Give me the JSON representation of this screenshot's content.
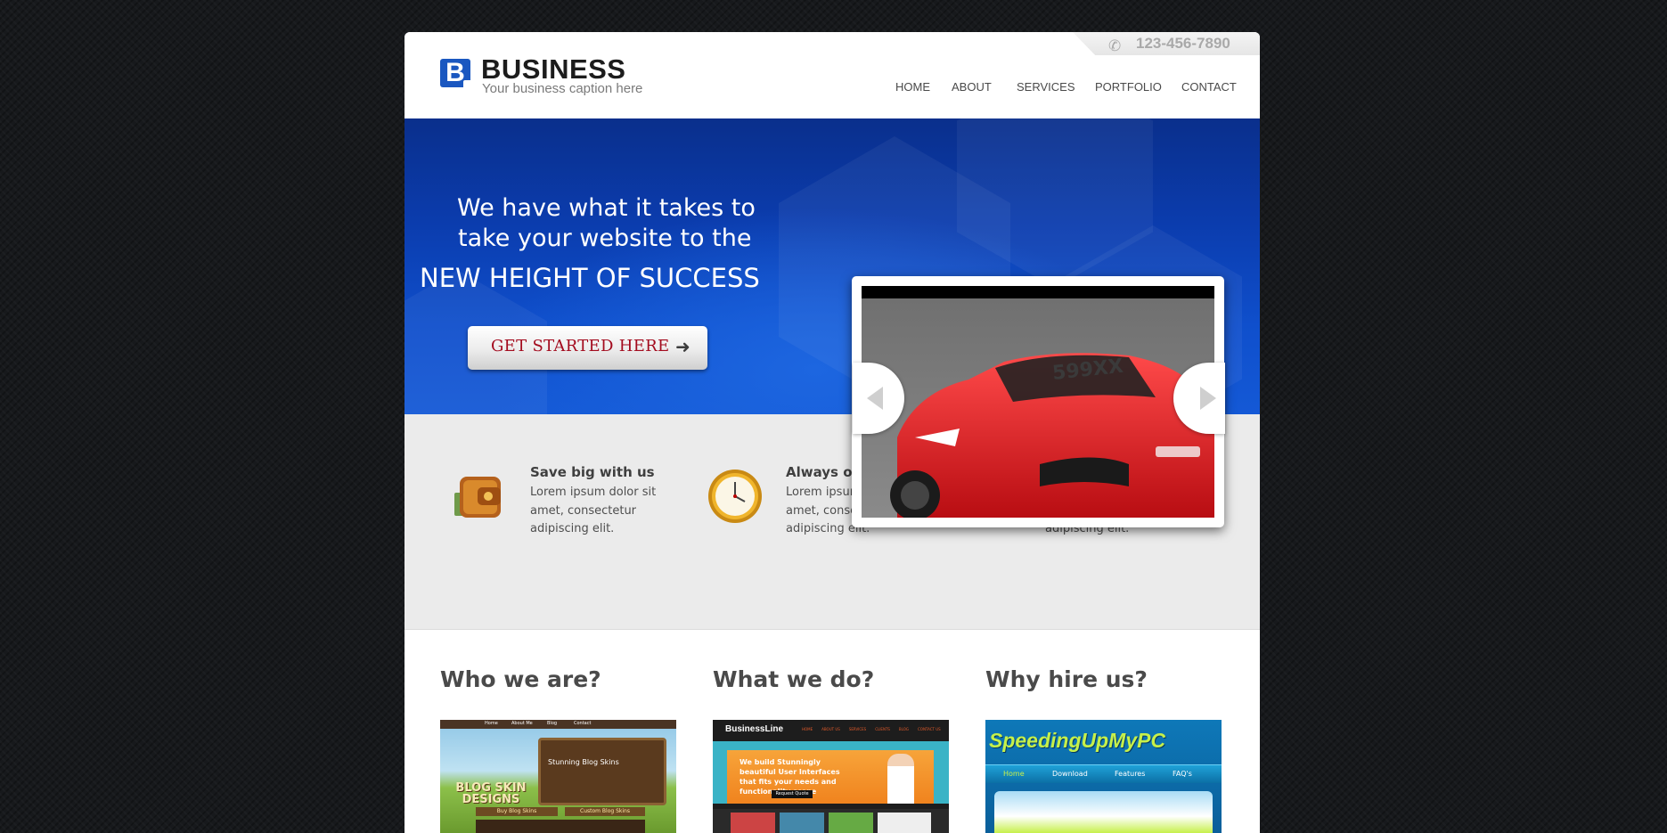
{
  "header": {
    "phone": "123-456-7890",
    "logo_letter": "B",
    "logo_title": "BUSINESS",
    "logo_caption": "Your business caption here",
    "nav": [
      "HOME",
      "ABOUT",
      "SERVICES",
      "PORTFOLIO",
      "CONTACT"
    ]
  },
  "hero": {
    "line1": "We have what it takes to",
    "line2": "take your website to the",
    "line3": "NEW HEIGHT OF SUCCESS",
    "cta_label": "GET STARTED HERE"
  },
  "features": [
    {
      "title": "Save big with us",
      "text": "Lorem ipsum dolor sit amet, consectetur adipiscing elit."
    },
    {
      "title": "Always on time",
      "text": "Lorem ipsum dolor sit amet, consectetur adipiscing elit."
    },
    {
      "title": "",
      "text": "adipiscing elit."
    }
  ],
  "columns": [
    {
      "title": "Who we are?"
    },
    {
      "title": "What we do?"
    },
    {
      "title": "Why hire us?"
    }
  ],
  "thumbs": {
    "blog": {
      "title": "BLOG SKIN DESIGNS",
      "heading": "Stunning Blog Skins",
      "button": "Buy Blog Skins",
      "side": "Custom Blog Skins",
      "nav": [
        "Home",
        "About Me",
        "Blog",
        "Contact"
      ]
    },
    "business": {
      "brand": "BusinessLine",
      "tagline": "We build Stunningly beautiful User Interfaces that fits your needs and functionality scope",
      "button": "Request Quote",
      "nav": [
        "HOME",
        "ABOUT US",
        "SERVICES",
        "CLIENTS",
        "BLOG",
        "CONTACT US"
      ]
    },
    "speed": {
      "brand": "SpeedingUpMyPC",
      "nav": [
        "Home",
        "Download",
        "Features",
        "FAQ's"
      ]
    }
  },
  "slider": {
    "plate": "599XX"
  },
  "colors": {
    "brand": "#1a57c0",
    "hero": "#0b3cad",
    "cta_text": "#a30b1e",
    "band": "#ebebeb"
  }
}
